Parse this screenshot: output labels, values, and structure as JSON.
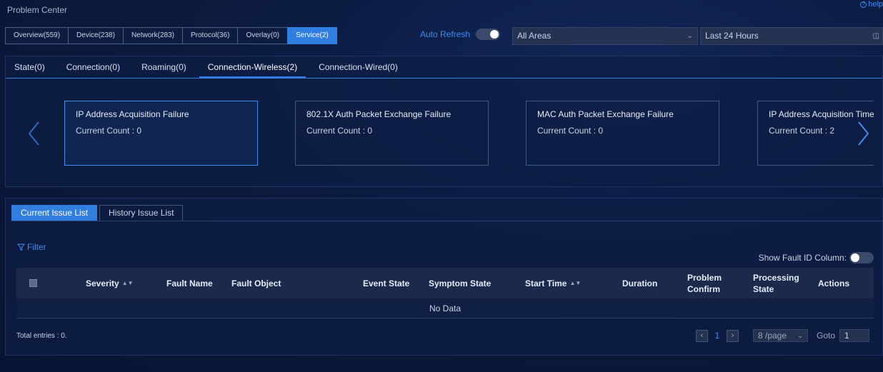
{
  "header": {
    "title": "Problem Center",
    "help": "help"
  },
  "top_tabs": [
    {
      "label": "Overview(559)",
      "active": false
    },
    {
      "label": "Device(238)",
      "active": false
    },
    {
      "label": "Network(283)",
      "active": false
    },
    {
      "label": "Protocol(36)",
      "active": false
    },
    {
      "label": "Overlay(0)",
      "active": false
    },
    {
      "label": "Service(2)",
      "active": true
    }
  ],
  "auto_refresh": {
    "label": "Auto Refresh",
    "on": false
  },
  "area_select": {
    "value": "All Areas"
  },
  "time_select": {
    "value": "Last 24 Hours"
  },
  "sub_tabs": [
    {
      "label": "State(0)",
      "active": false
    },
    {
      "label": "Connection(0)",
      "active": false
    },
    {
      "label": "Roaming(0)",
      "active": false
    },
    {
      "label": "Connection-Wireless(2)",
      "active": true
    },
    {
      "label": "Connection-Wired(0)",
      "active": false
    }
  ],
  "cards": [
    {
      "name": "IP Address Acquisition Failure",
      "count": "Current Count : 0",
      "active": true
    },
    {
      "name": "802.1X Auth Packet Exchange Failure",
      "count": "Current Count : 0",
      "active": false
    },
    {
      "name": "MAC Auth Packet Exchange Failure",
      "count": "Current Count : 0",
      "active": false
    },
    {
      "name": "IP Address Acquisition Timeout",
      "count": "Current Count : 2",
      "active": false
    }
  ],
  "list_tabs": [
    {
      "label": "Current Issue List",
      "active": true
    },
    {
      "label": "History Issue List",
      "active": false
    }
  ],
  "filter": {
    "label": "Filter"
  },
  "show_fault": {
    "label": "Show Fault ID Column:",
    "on": false
  },
  "table": {
    "columns": [
      "Severity",
      "Fault Name",
      "Fault Object",
      "Event State",
      "Symptom State",
      "Start Time",
      "Duration",
      "Problem Confirm",
      "Processing State",
      "Actions"
    ],
    "empty_text": "No Data"
  },
  "pagination": {
    "total": "Total entries : 0.",
    "current_page": "1",
    "page_size": "8 /page",
    "goto_label": "Goto",
    "goto_value": "1"
  },
  "colors": {
    "accent": "#2f7ee0",
    "link": "#3f8cf0",
    "background": "#0b1a3e"
  }
}
